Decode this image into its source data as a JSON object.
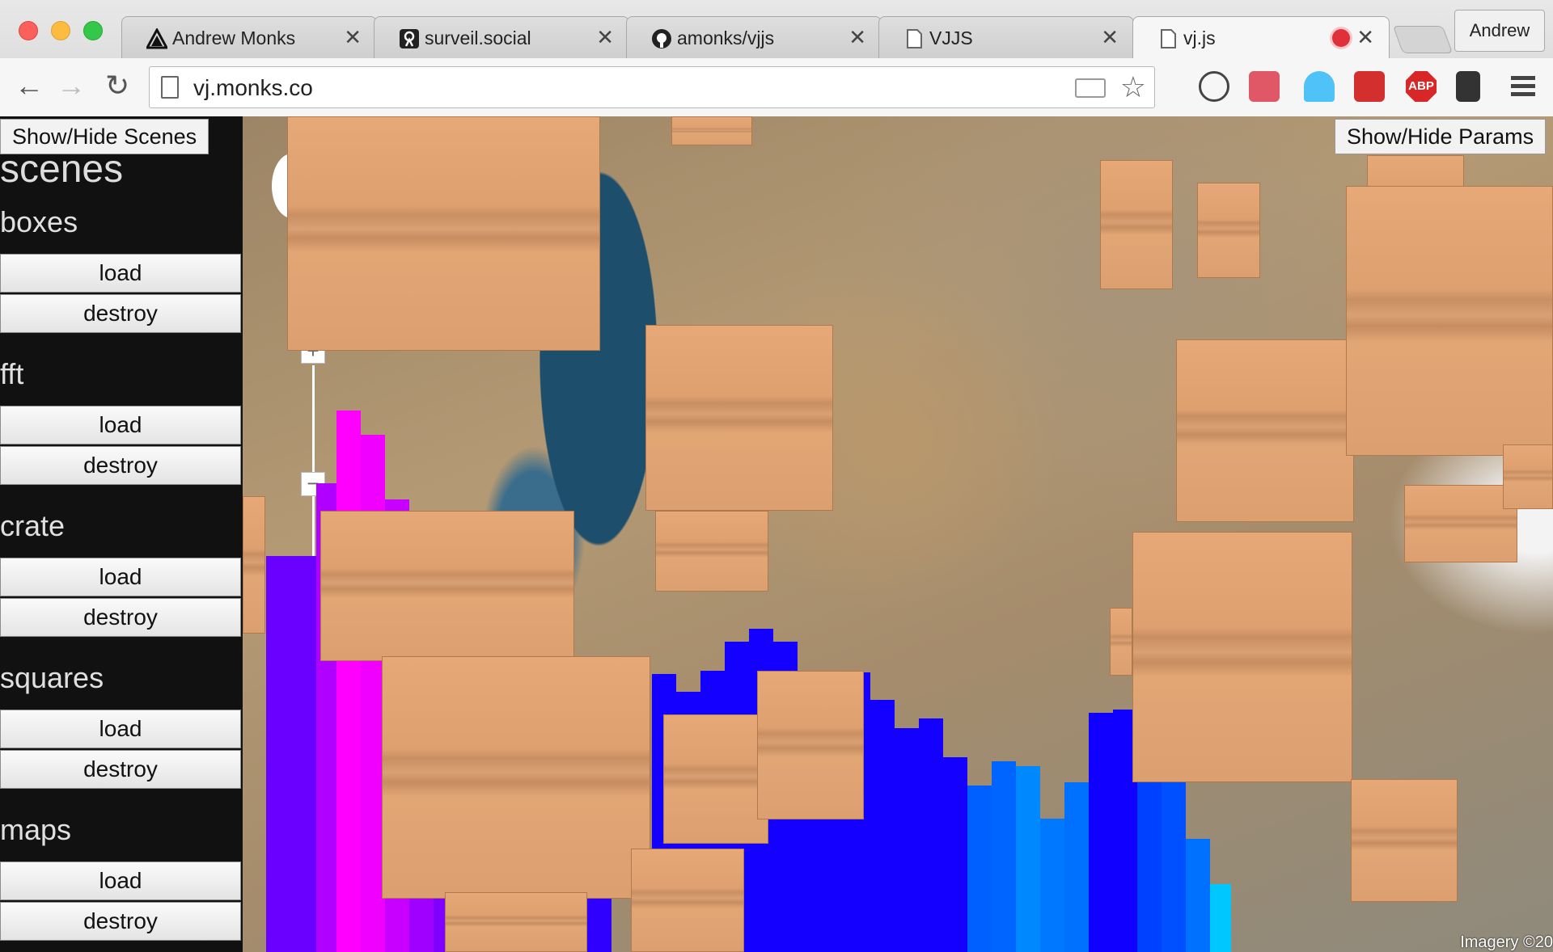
{
  "tabs": [
    {
      "title": "Andrew Monks",
      "icon": "triangle-logo-icon"
    },
    {
      "title": "surveil.social",
      "icon": "ghost-logo-icon"
    },
    {
      "title": "amonks/vjjs",
      "icon": "github-icon"
    },
    {
      "title": "VJJS",
      "icon": "page-icon"
    },
    {
      "title": "vj.js",
      "icon": "page-icon",
      "active": true,
      "recording": true
    }
  ],
  "profile": "Andrew",
  "url": "vj.monks.co",
  "sidebar": {
    "toggle_label": "Show/Hide Scenes",
    "heading": "scenes",
    "scenes": [
      {
        "name": "boxes",
        "load": "load",
        "destroy": "destroy"
      },
      {
        "name": "fft",
        "load": "load",
        "destroy": "destroy"
      },
      {
        "name": "crate",
        "load": "load",
        "destroy": "destroy"
      },
      {
        "name": "squares",
        "load": "load",
        "destroy": "destroy"
      },
      {
        "name": "maps",
        "load": "load",
        "destroy": "destroy"
      }
    ]
  },
  "params_toggle_label": "Show/Hide Params",
  "map": {
    "attribution": "Imagery ©20",
    "zoom_in": "+",
    "zoom_out": "−"
  },
  "colors": {
    "bar_purple": "#6a00ff",
    "bar_magenta": "#ff00ff",
    "bar_blue": "#1400ff",
    "bar_cyan": "#00c8ff",
    "box": "#dfa070"
  }
}
